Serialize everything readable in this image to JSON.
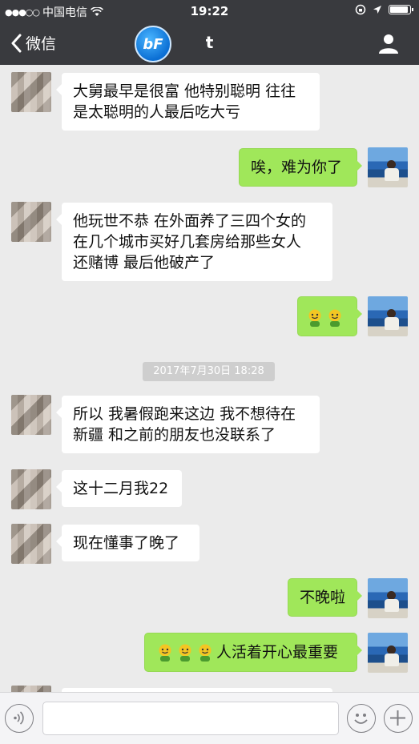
{
  "status_bar": {
    "carrier": "中国电信",
    "time": "19:22",
    "battery_level": 0.85
  },
  "nav": {
    "back_label": "微信",
    "title": "t",
    "logo_text": "bF"
  },
  "timestamp": "2017年7月30日 18:28",
  "messages": [
    {
      "side": "left",
      "text": "大舅最早是很富 他特别聪明 往往\n是太聪明的人最后吃大亏"
    },
    {
      "side": "right",
      "text": "唉，难为你了"
    },
    {
      "side": "left",
      "text": "他玩世不恭 在外面养了三四个女的\n在几个城市买好几套房给那些女人\n还赌博  最后他破产了"
    },
    {
      "side": "right",
      "emojis": [
        "emoji",
        "emoji"
      ],
      "text": ""
    },
    {
      "side": "left",
      "text": "所以 我暑假跑来这边 我不想待在\n新疆 和之前的朋友也没联系了"
    },
    {
      "side": "left",
      "text": "这十二月我22"
    },
    {
      "side": "left",
      "text": "现在懂事了晚了"
    },
    {
      "side": "right",
      "text": "不晚啦"
    },
    {
      "side": "right",
      "emojis": [
        "emoji",
        "emoji",
        "emoji"
      ],
      "text": "人活着开心最重要"
    }
  ],
  "input": {
    "placeholder": ""
  },
  "icons": {
    "back": "chevron-left-icon",
    "profile": "person-icon",
    "voice": "voice-icon",
    "emoji": "smiley-icon",
    "plus": "plus-icon"
  },
  "colors": {
    "nav_bg": "#393a3e",
    "chat_bg": "#ebebeb",
    "bubble_self": "#a0e75a",
    "bubble_other": "#ffffff"
  }
}
